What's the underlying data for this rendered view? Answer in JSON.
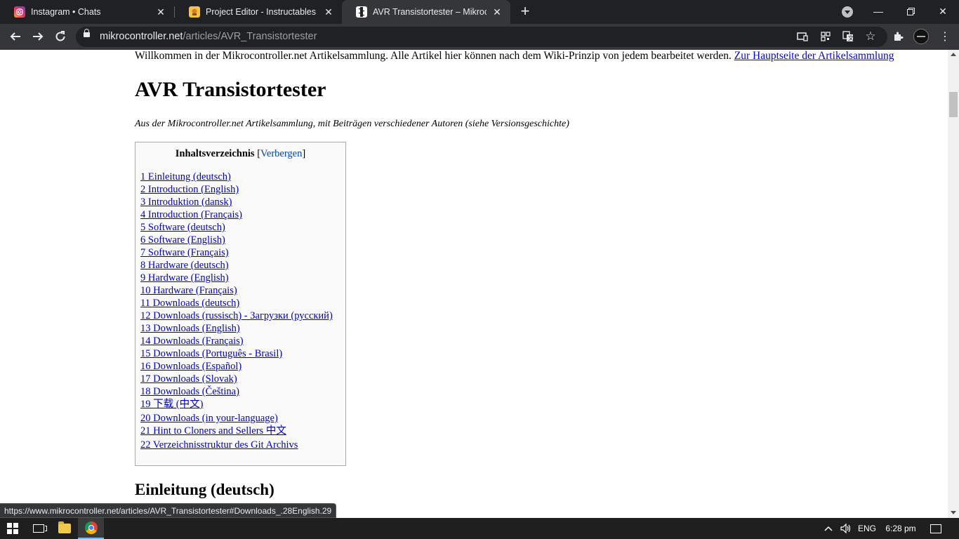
{
  "browser": {
    "tabs": [
      {
        "title": "Instagram • Chats",
        "icon": "instagram-icon",
        "active": false
      },
      {
        "title": "Project Editor - Instructables",
        "icon": "instructables-icon",
        "active": false
      },
      {
        "title": "AVR Transistortester – Mikrocontroller.net",
        "icon": "page-icon",
        "active": true
      }
    ],
    "url_host": "mikrocontroller.net",
    "url_path": "/articles/AVR_Transistortester",
    "status_url": "https://www.mikrocontroller.net/articles/AVR_Transistortester#Downloads_.28English.29"
  },
  "page": {
    "welcome_text": "Willkommen in der Mikrocontroller.net Artikelsammlung. Alle Artikel hier können nach dem Wiki-Prinzip von jedem bearbeitet werden. ",
    "welcome_link": "Zur Hauptseite der Artikelsammlung",
    "title": "AVR Transistortester",
    "subtitle": "Aus der Mikrocontroller.net Artikelsammlung, mit Beiträgen verschiedener Autoren (siehe Versionsgeschichte)",
    "toc": {
      "heading": "Inhaltsverzeichnis",
      "toggle": "Verbergen",
      "items": [
        "1 Einleitung (deutsch)",
        "2 Introduction (English)",
        "3 Introduktion (dansk)",
        "4 Introduction (Français)",
        "5 Software (deutsch)",
        "6 Software (English)",
        "7 Software (Français)",
        "8 Hardware (deutsch)",
        "9 Hardware (English)",
        "10 Hardware (Français)",
        "11 Downloads (deutsch)",
        "12 Downloads (russisch) - Загрузки (русский)",
        "13 Downloads (English)",
        "14 Downloads (Français)",
        "15 Downloads (Português - Brasil)",
        "16 Downloads (Español)",
        "17 Downloads (Slovak)",
        "18 Downloads (Čeština)",
        "19 下载 (中文)",
        "20 Downloads (in your-language)",
        "21 Hint to Cloners and Sellers 中文",
        "22 Verzeichnisstruktur des Git Archivs"
      ]
    },
    "section_heading": "Einleitung (deutsch)"
  },
  "taskbar": {
    "language": "ENG",
    "time": "6:28 pm"
  },
  "colors": {
    "chrome_dark": "#202124",
    "toolbar": "#35363a",
    "link": "#0000cc",
    "toc_bg": "#f9f9f9"
  }
}
